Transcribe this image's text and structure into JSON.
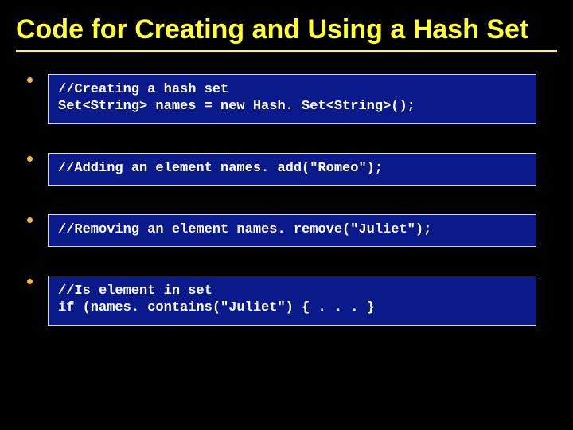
{
  "title": "Code for Creating and Using a Hash Set",
  "items": [
    {
      "code": "//Creating a hash set\nSet<String> names = new Hash. Set<String>();"
    },
    {
      "code": "//Adding an element names. add(\"Romeo\");"
    },
    {
      "code": "//Removing an element names. remove(\"Juliet\");"
    },
    {
      "code": "//Is element in set\nif (names. contains(\"Juliet\") { . . . }"
    }
  ]
}
